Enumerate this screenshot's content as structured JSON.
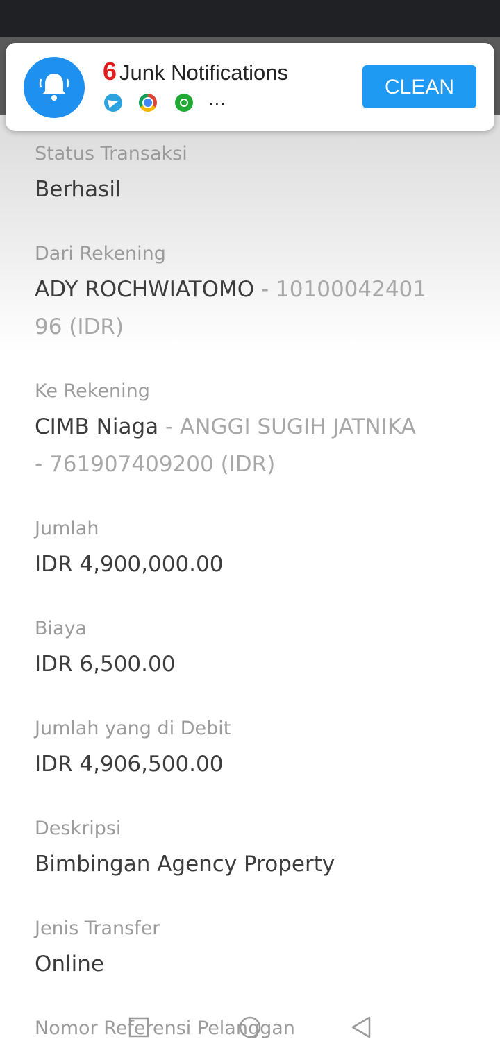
{
  "notification": {
    "count": "6",
    "title": "Junk Notifications",
    "apps": [
      "telegram-icon",
      "chrome-icon",
      "gojek-icon"
    ],
    "more": "...",
    "button_label": "CLEAN"
  },
  "details": [
    {
      "label": "Status Transaksi",
      "value": "Berhasil"
    },
    {
      "label": "Dari Rekening",
      "value_main": "ADY ROCHWIATOMO",
      "value_muted": " - 10100042401",
      "value_line2": "96 (IDR)"
    },
    {
      "label": "Ke Rekening",
      "value_main": "CIMB Niaga",
      "value_muted": " - ANGGI SUGIH JATNIKA",
      "value_line2": "- 761907409200 (IDR)"
    },
    {
      "label": "Jumlah",
      "value": "IDR 4,900,000.00"
    },
    {
      "label": "Biaya",
      "value": "IDR 6,500.00"
    },
    {
      "label": "Jumlah yang di Debit",
      "value": "IDR 4,906,500.00"
    },
    {
      "label": "Deskripsi",
      "value": "Bimbingan Agency Property"
    },
    {
      "label": "Jenis Transfer",
      "value": "Online"
    },
    {
      "label": "Nomor Referensi Pelanggan"
    }
  ],
  "nav": [
    "recent-apps-icon",
    "home-icon",
    "back-icon"
  ],
  "colors": {
    "accent": "#1e9af2",
    "count": "#e11d1d"
  }
}
